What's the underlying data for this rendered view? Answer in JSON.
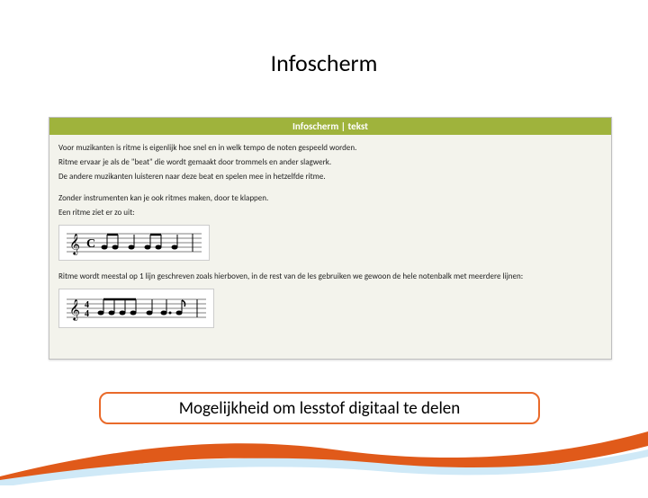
{
  "slide": {
    "title": "Infoscherm"
  },
  "panel": {
    "header": "Infoscherm | tekst",
    "p1": "Voor muzikanten is ritme is eigenlijk hoe snel en in welk tempo de noten gespeeld worden.",
    "p2": "Ritme ervaar je als de \"beat\" die wordt gemaakt door trommels en ander slagwerk.",
    "p3": "De andere muzikanten luisteren naar deze beat en spelen mee in hetzelfde ritme.",
    "p4": "Zonder instrumenten kan je ook ritmes maken, door te klappen.",
    "p5": "Een ritme ziet er zo uit:",
    "p6": "Ritme wordt meestal op 1 lijn geschreven zoals hierboven, in de rest van de les gebruiken we gewoon de hele notenbalk met meerdere lijnen:"
  },
  "caption": {
    "text": "Mogelijkheid om lesstof digitaal te delen"
  }
}
